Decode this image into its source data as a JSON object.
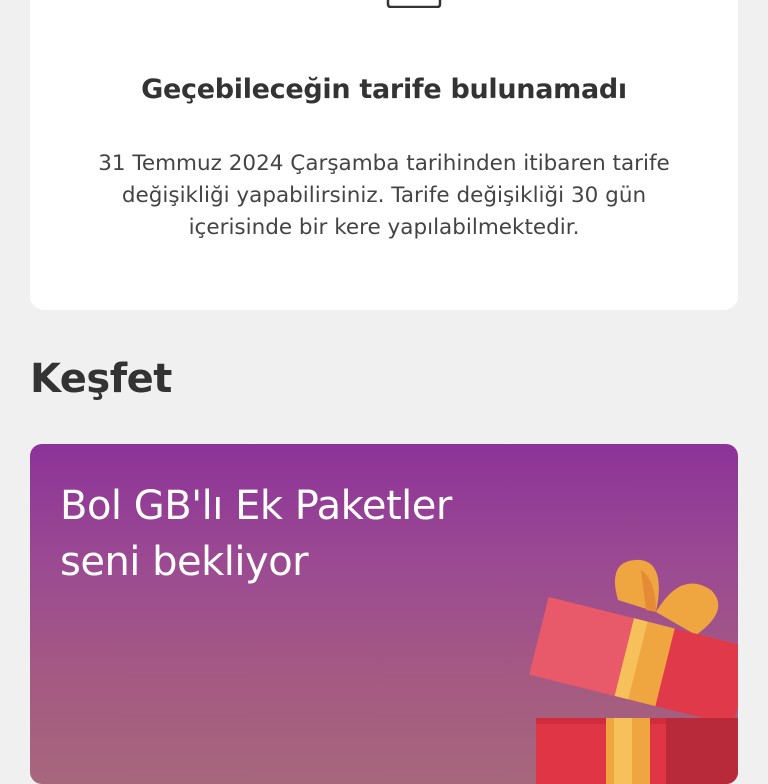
{
  "card": {
    "title": "Geçebileceğin tarife bulunamadı",
    "body_line1": "31 Temmuz 2024 Çarşamba tarihinden itibaren tarife",
    "body_line2": "değişikliği yapabilirsiniz. Tarife değişikliği 30 gün",
    "body_line3": "içerisinde bir kere yapılabilmektedir.",
    "icon": "calendar-icon"
  },
  "section": {
    "title": "Keşfet"
  },
  "promo": {
    "line1": "Bol GB'lı Ek Paketler",
    "line2": "seni bekliyor",
    "illustration": "gift-box-icon"
  },
  "colors": {
    "background": "#f0f0f0",
    "card": "#ffffff",
    "promo_top": "#8c3399",
    "promo_bottom": "#a6677c"
  }
}
